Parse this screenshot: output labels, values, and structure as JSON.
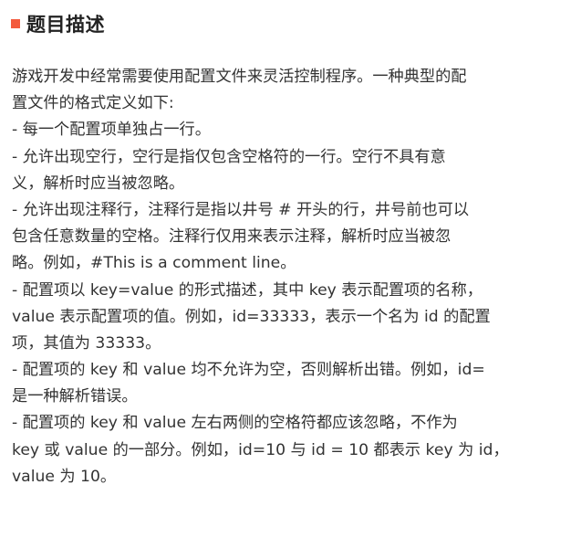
{
  "section": {
    "title": "题目描述",
    "marker_color": "#f35a3c"
  },
  "description": {
    "lines": [
      "游戏开发中经常需要使用配置文件来灵活控制程序。一种典型的配",
      "置文件的格式定义如下:",
      "- 每一个配置项单独占一行。",
      "- 允许出现空行，空行是指仅包含空格符的一行。空行不具有意",
      "义，解析时应当被忽略。",
      "- 允许出现注释行，注释行是指以井号 # 开头的行，井号前也可以",
      "包含任意数量的空格。注释行仅用来表示注释，解析时应当被忽",
      "略。例如，#This is a comment line。",
      "- 配置项以 key=value 的形式描述，其中 key 表示配置项的名称，",
      "value 表示配置项的值。例如，id=33333，表示一个名为 id 的配置",
      "项，其值为 33333。",
      "- 配置项的 key 和 value 均不允许为空，否则解析出错。例如，id=",
      "是一种解析错误。",
      "- 配置项的 key 和 value 左右两侧的空格符都应该忽略，不作为",
      "key 或 value 的一部分。例如，id=10 与 id = 10 都表示 key 为 id，",
      "value 为 10。"
    ]
  }
}
